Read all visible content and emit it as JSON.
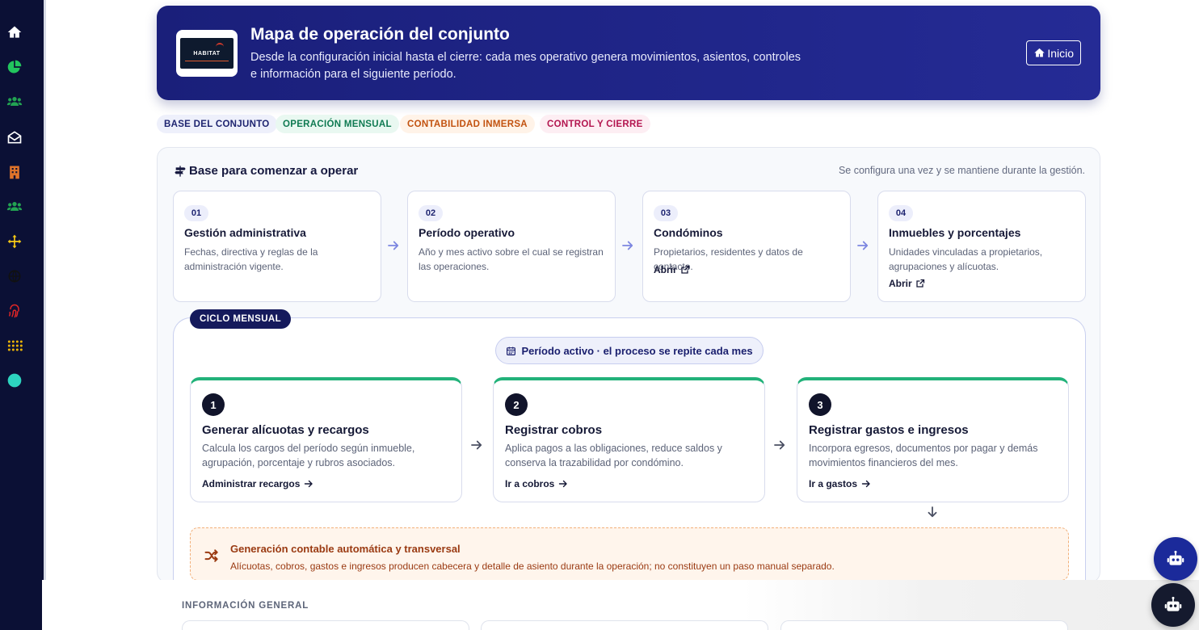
{
  "sidebar": {
    "items": [
      {
        "icon": "home-icon",
        "color": "#ffffff"
      },
      {
        "icon": "pie-chart-icon",
        "color": "#22c55e"
      },
      {
        "icon": "users-icon",
        "color": "#22a352"
      },
      {
        "icon": "envelope-open-icon",
        "color": "#ffffff"
      },
      {
        "icon": "building-icon",
        "color": "#e0742a"
      },
      {
        "icon": "users-icon",
        "color": "#22a352"
      },
      {
        "icon": "arrows-move-icon",
        "color": "#facc15"
      },
      {
        "icon": "globe-icon",
        "color": "#111111"
      },
      {
        "icon": "fingerprint-icon",
        "color": "#e12626"
      },
      {
        "icon": "grid-dots-icon",
        "color": "#eab308"
      },
      {
        "icon": "circle-icon",
        "color": "#2dd4bf"
      }
    ]
  },
  "hero": {
    "logo_text": "HABITAT",
    "title": "Mapa de operación del conjunto",
    "description": "Desde la configuración inicial hasta el cierre: cada mes operativo genera movimientos, asientos, controles e información para el siguiente período.",
    "button_label": "Inicio"
  },
  "chips": [
    {
      "label": "BASE DEL CONJUNTO",
      "color": "#1e2470",
      "bg": "#eef0fb"
    },
    {
      "label": "OPERACIÓN MENSUAL",
      "color": "#0f7a52",
      "bg": "#e9f8f1"
    },
    {
      "label": "CONTABILIDAD INMERSA",
      "color": "#c2520f",
      "bg": "#fff3e8"
    },
    {
      "label": "CONTROL Y CIERRE",
      "color": "#b3154f",
      "bg": "#fdeef3"
    }
  ],
  "base": {
    "title": "Base para comenzar a operar",
    "note": "Se configura una vez y se mantiene durante la gestión.",
    "steps": [
      {
        "num": "01",
        "title": "Gestión administrativa",
        "desc": "Fechas, directiva y reglas de la administración vigente.",
        "link": ""
      },
      {
        "num": "02",
        "title": "Período operativo",
        "desc": "Año y mes activo sobre el cual se registran las operaciones.",
        "link": ""
      },
      {
        "num": "03",
        "title": "Condóminos",
        "desc": "Propietarios, residentes y datos de contacto.",
        "link": "Abrir"
      },
      {
        "num": "04",
        "title": "Inmuebles y porcentajes",
        "desc": "Unidades vinculadas a propietarios, agrupaciones y alícuotas.",
        "link": "Abrir"
      }
    ]
  },
  "cycle": {
    "tag": "CICLO MENSUAL",
    "period": "Período activo · el proceso se repite cada mes",
    "steps": [
      {
        "num": "1",
        "title": "Generar alícuotas y recargos",
        "desc": "Calcula los cargos del período según inmueble, agrupación, porcentaje y rubros asociados.",
        "link": "Administrar recargos"
      },
      {
        "num": "2",
        "title": "Registrar cobros",
        "desc": "Aplica pagos a las obligaciones, reduce saldos y conserva la trazabilidad por condómino.",
        "link": "Ir a cobros"
      },
      {
        "num": "3",
        "title": "Registrar gastos e ingresos",
        "desc": "Incorpora egresos, documentos por pagar y demás movimientos financieros del mes.",
        "link": "Ir a gastos"
      }
    ],
    "auto": {
      "title": "Generación contable automática y transversal",
      "desc": "Alícuotas, cobros, gastos e ingresos producen cabecera y detalle de asiento durante la operación; no constituyen un paso manual separado."
    }
  },
  "lower": {
    "title": "INFORMACIÓN GENERAL"
  },
  "colors": {
    "accent": "#1a1f7a",
    "cycle_top": "#22b27a",
    "bot_primary": "#1b2a9a",
    "bot_secondary": "#151a2e"
  }
}
